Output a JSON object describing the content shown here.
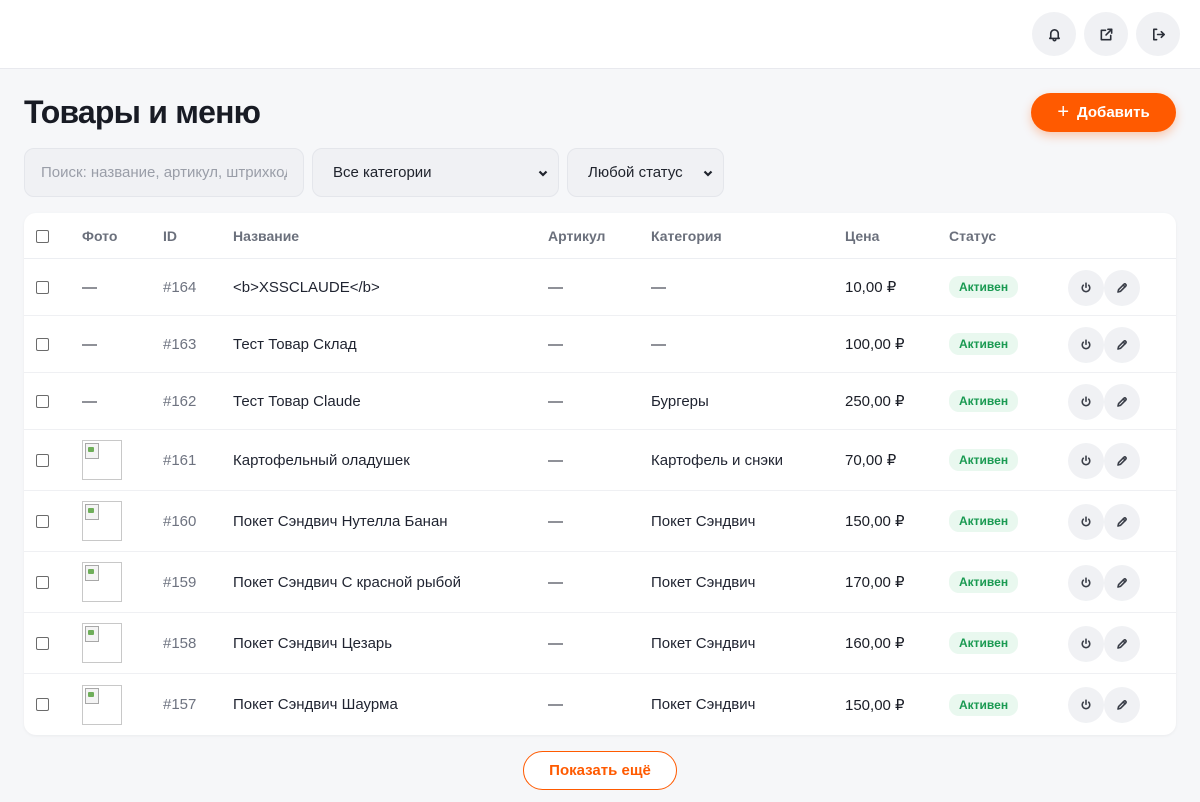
{
  "header": {
    "icons": [
      "bell-icon",
      "external-link-icon",
      "logout-icon"
    ]
  },
  "page": {
    "title": "Товары и меню",
    "add_label": "Добавить",
    "add_icon": "+",
    "show_more_label": "Показать ещё"
  },
  "filters": {
    "search_placeholder": "Поиск: название, артикул, штрихкод",
    "category_selected": "Все категории",
    "status_selected": "Любой статус"
  },
  "table": {
    "columns": {
      "photo": "Фото",
      "id": "ID",
      "name": "Название",
      "sku": "Артикул",
      "category": "Категория",
      "price": "Цена",
      "status": "Статус"
    },
    "rows": [
      {
        "photo": "—",
        "id": "#164",
        "name": "<b>XSSCLAUDE</b>",
        "sku": "—",
        "category": "—",
        "price": "10,00 ₽",
        "status": "Активен",
        "has_image": false
      },
      {
        "photo": "—",
        "id": "#163",
        "name": "Тест Товар Склад",
        "sku": "—",
        "category": "—",
        "price": "100,00 ₽",
        "status": "Активен",
        "has_image": false
      },
      {
        "photo": "—",
        "id": "#162",
        "name": "Тест Товар Claude",
        "sku": "—",
        "category": "Бургеры",
        "price": "250,00 ₽",
        "status": "Активен",
        "has_image": false
      },
      {
        "photo": "",
        "id": "#161",
        "name": "Картофельный оладушек",
        "sku": "—",
        "category": "Картофель и снэки",
        "price": "70,00 ₽",
        "status": "Активен",
        "has_image": true
      },
      {
        "photo": "",
        "id": "#160",
        "name": "Покет Сэндвич Нутелла Банан",
        "sku": "—",
        "category": "Покет Сэндвич",
        "price": "150,00 ₽",
        "status": "Активен",
        "has_image": true
      },
      {
        "photo": "",
        "id": "#159",
        "name": "Покет Сэндвич С красной рыбой",
        "sku": "—",
        "category": "Покет Сэндвич",
        "price": "170,00 ₽",
        "status": "Активен",
        "has_image": true
      },
      {
        "photo": "",
        "id": "#158",
        "name": "Покет Сэндвич Цезарь",
        "sku": "—",
        "category": "Покет Сэндвич",
        "price": "160,00 ₽",
        "status": "Активен",
        "has_image": true
      },
      {
        "photo": "",
        "id": "#157",
        "name": "Покет Сэндвич Шаурма",
        "sku": "—",
        "category": "Покет Сэндвич",
        "price": "150,00 ₽",
        "status": "Активен",
        "has_image": true
      }
    ]
  },
  "colors": {
    "accent": "#ff5a00",
    "status_active_bg": "#e9f8ef",
    "status_active_text": "#1a9a52"
  }
}
